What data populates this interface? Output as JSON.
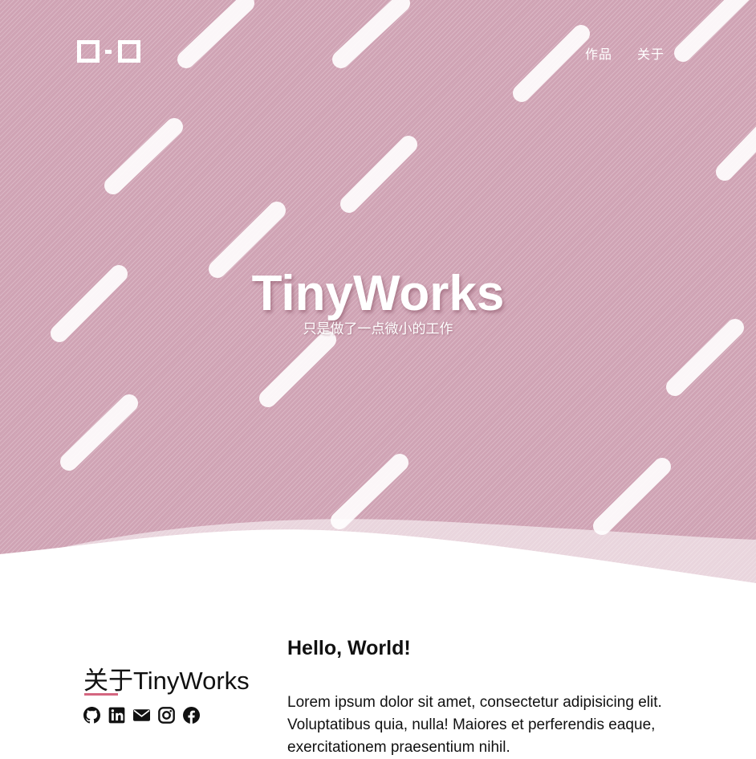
{
  "header": {
    "nav": [
      {
        "label": "作品"
      },
      {
        "label": "关于"
      }
    ]
  },
  "hero": {
    "title": "TinyWorks",
    "subtitle": "只是做了一点微小的工作"
  },
  "about": {
    "title": "关于TinyWorks",
    "social": [
      {
        "icon": "github-icon",
        "label": "GitHub"
      },
      {
        "icon": "linkedin-icon",
        "label": "LinkedIn"
      },
      {
        "icon": "envelope-icon",
        "label": "Email"
      },
      {
        "icon": "instagram-icon",
        "label": "Instagram"
      },
      {
        "icon": "facebook-icon",
        "label": "Facebook"
      }
    ]
  },
  "content": {
    "heading": "Hello, World!",
    "body": "Lorem ipsum dolor sit amet, consectetur adipisicing elit. Voluptatibus quia, nulla! Maiores et perferendis eaque, exercitationem praesentium nihil."
  },
  "colors": {
    "hero_background": "#cfa3b4",
    "accent_underline": "#d46680",
    "text": "#111111"
  }
}
